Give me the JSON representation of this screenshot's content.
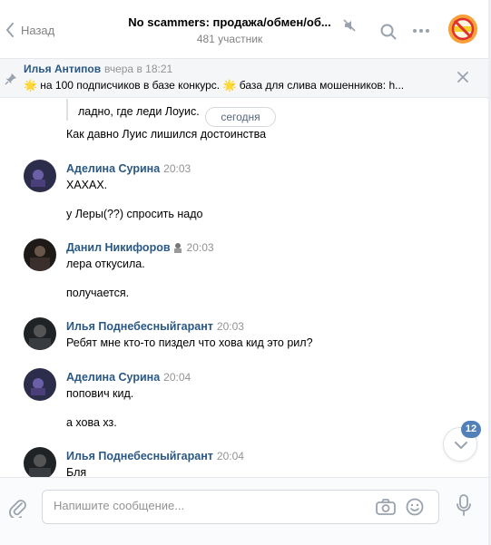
{
  "header": {
    "back_label": "Назад",
    "chat_title": "No scammers: продажа/обмен/об...",
    "members": "481 участник"
  },
  "pinned": {
    "author": "Илья Антипов",
    "time": "вчера в 18:21",
    "text": "🌟 на 100 подписчиков в базе конкурс. 🌟 база для слива мошенников: h..."
  },
  "messages": {
    "quote_text": "ладно, где леди Лоуис.",
    "date_divider": "сегодня",
    "prev_line": "Как давно Луис лишился достоинства",
    "groups": [
      {
        "author": "Аделина Сурина",
        "time": "20:03",
        "lines": [
          "ХАХАХ.",
          "у Леры(??) спросить надо"
        ]
      },
      {
        "author": "Данил Никифоров",
        "time": "20:03",
        "lines": [
          "лера откусила.",
          "получается."
        ]
      },
      {
        "author": "Илья Поднебесныйгарант",
        "time": "20:03",
        "lines": [
          "Ребят мне кто-то пиздел что хова кид это рил?"
        ]
      },
      {
        "author": "Аделина Сурина",
        "time": "20:04",
        "lines": [
          "попович кид.",
          "а хова хз."
        ]
      },
      {
        "author": "Илья Поднебесныйгарант",
        "time": "20:04",
        "lines": [
          "Бля"
        ]
      }
    ]
  },
  "scroll_badge": "12",
  "composer": {
    "placeholder": "Напишите сообщение..."
  },
  "colors": {
    "link_blue": "#2a5885",
    "badge_blue": "#5181b8",
    "muted_gray": "#828282"
  },
  "icons": [
    "back-arrow-icon",
    "mute-icon",
    "search-icon",
    "more-icon",
    "pin-icon",
    "close-icon",
    "chevron-down-icon",
    "paperclip-icon",
    "camera-icon",
    "smile-icon",
    "microphone-icon"
  ]
}
